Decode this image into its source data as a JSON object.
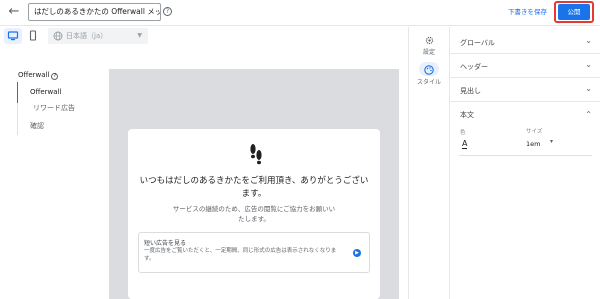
{
  "header": {
    "title_value": "はだしのあるきかたの Offerwall メッセ",
    "save_draft": "下書きを保存",
    "publish": "公開"
  },
  "toolbar": {
    "language": "日本語（ja）"
  },
  "nav": {
    "title": "Offerwall",
    "items": [
      "Offerwall",
      "リワード広告",
      "確認"
    ]
  },
  "preview": {
    "headline": "いつもはだしのあるきかたをご利用頂き、ありがとうございます。",
    "subtext": "サービスの継続のため、広告の閲覧にご協力をお願いいたします。",
    "option_title": "短い広告を見る",
    "option_desc": "一度広告をご覧いただくと、一定期間、同じ形式の広告は表示されなくなります。"
  },
  "rail": {
    "settings": "設定",
    "style": "スタイル"
  },
  "panel": {
    "sections": [
      "グローバル",
      "ヘッダー",
      "見出し",
      "本文"
    ],
    "color_label": "色",
    "size_label": "サイズ",
    "color_glyph": "A",
    "size_value": "1em"
  },
  "colors": {
    "accent": "#1a73e8",
    "highlight_ring": "#e53935",
    "canvas": "#dadce0"
  },
  "icons": [
    "back-arrow-icon",
    "help-icon",
    "desktop-icon",
    "mobile-icon",
    "globe-icon",
    "footprints-icon",
    "arrow-right-icon",
    "gear-icon",
    "palette-icon",
    "chevron-down-icon",
    "chevron-up-icon"
  ]
}
